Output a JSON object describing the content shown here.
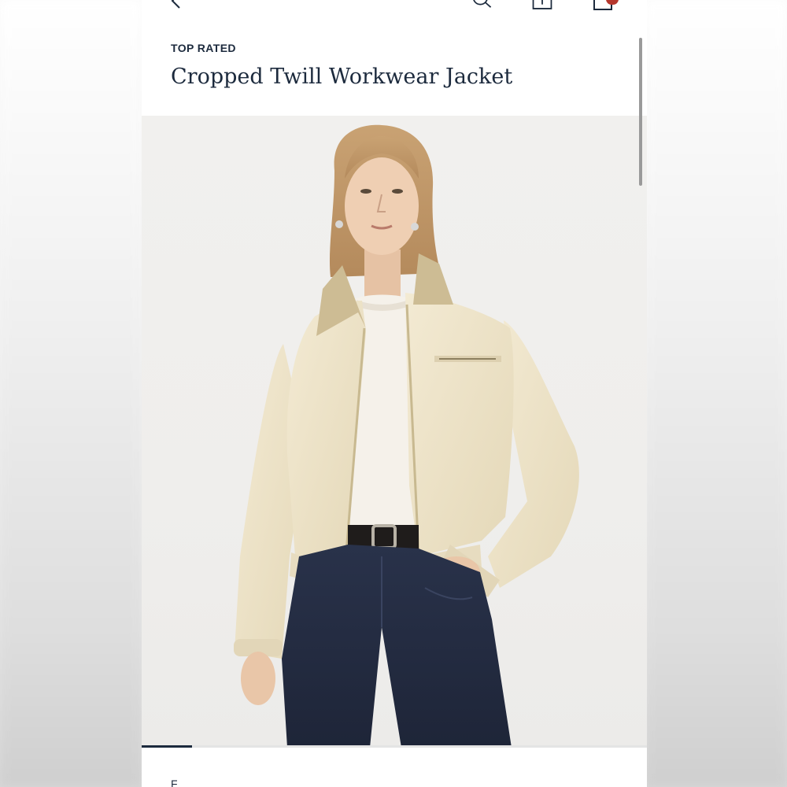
{
  "app": {
    "colors": {
      "text_primary": "#1c2a3d",
      "badge": "#b5372d",
      "background": "#ffffff"
    }
  },
  "header": {
    "icons": [
      "back-icon",
      "search-icon",
      "share-icon",
      "shopping-bag-icon"
    ]
  },
  "product": {
    "eyebrow": "TOP RATED",
    "title": "Cropped Twill Workwear Jacket",
    "image": {
      "description_icon": "product-photo",
      "carousel": {
        "active_index": 1,
        "total_visible_fraction": 0.1
      }
    },
    "below_fold_text": "F"
  }
}
